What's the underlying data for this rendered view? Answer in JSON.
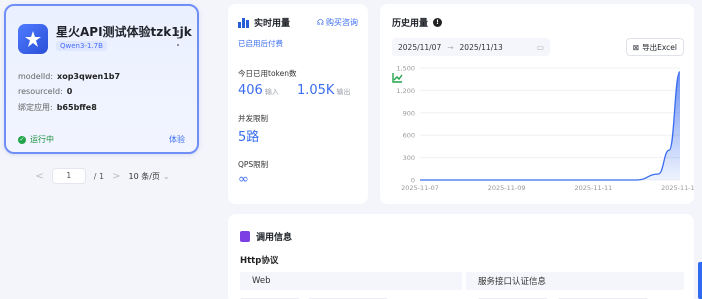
{
  "app_card": {
    "title": "星火API测试体验tzk1jk",
    "model": "Qwen3-1.7B",
    "modelid_label": "modelId:",
    "modelid_value": "xop3qwen1b7",
    "resourceid_label": "resourceId:",
    "resourceid_value": "0",
    "bound_app_label": "绑定应用:",
    "bound_app_value": "b65bffe8",
    "status": "运行中",
    "try_label": "体验",
    "logo_icon": "xinghuo-logo-icon",
    "accent": "#4a6cf7"
  },
  "pagination": {
    "prev": "<",
    "current": "1",
    "total": "/ 1",
    "next": ">",
    "page_size": "10 条/页"
  },
  "realtime": {
    "title": "实时用量",
    "buy_link": "购买咨询",
    "billing": "已启用后付费",
    "today_tokens_label": "今日已用token数",
    "input_value": "406",
    "input_unit": "输入",
    "output_value": "1.05K",
    "output_unit": "输出",
    "concurrency_label": "并发限制",
    "concurrency_value": "5路",
    "qps_label": "QPS限制",
    "qps_value": "∞"
  },
  "history": {
    "title": "历史用量",
    "date_start": "2025/11/07",
    "date_sep": "→",
    "date_end": "2025/11/13",
    "export_label": "导出Excel"
  },
  "invoke": {
    "title": "调用信息",
    "protocol": "Http协议",
    "tab_web": "Web",
    "tab_auth": "服务接口认证信息"
  },
  "chart_data": {
    "type": "area",
    "x": [
      "2025-11-07",
      "2025-11-08",
      "2025-11-09",
      "2025-11-10",
      "2025-11-11",
      "2025-11-12",
      "2025-11-12 12:00",
      "2025-11-12 18:00",
      "2025-11-13"
    ],
    "x_ticks": [
      "2025-11-07",
      "2025-11-09",
      "2025-11-11",
      "2025-11-13"
    ],
    "y": [
      0,
      0,
      0,
      0,
      0,
      0,
      80,
      400,
      1450
    ],
    "ylim": [
      0,
      1500
    ],
    "y_ticks": [
      "0",
      "300",
      "600",
      "900",
      "1,200",
      "1,500"
    ],
    "grid": true,
    "color": "#3a6df0"
  }
}
